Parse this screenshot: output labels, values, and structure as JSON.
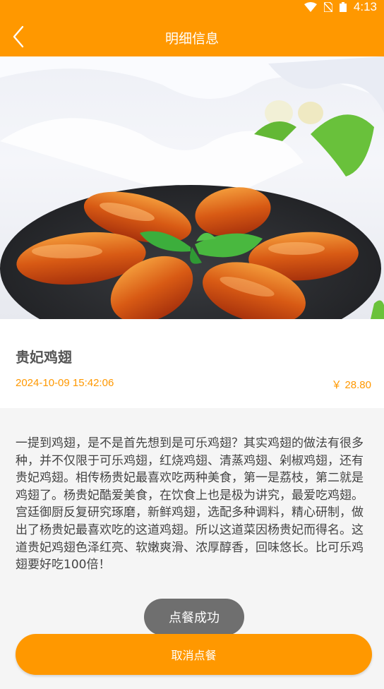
{
  "status_bar": {
    "time": "4:13",
    "wifi_icon": "wifi-icon",
    "sim_icon": "no-sim-icon",
    "battery_icon": "battery-icon"
  },
  "header": {
    "title": "明细信息",
    "back_icon": "back-arrow-icon"
  },
  "dish": {
    "name": "贵妃鸡翅",
    "datetime": "2024-10-09 15:42:06",
    "price": "￥ 28.80",
    "description": "一提到鸡翅，是不是首先想到是可乐鸡翅？其实鸡翅的做法有很多种，并不仅限于可乐鸡翅，红烧鸡翅、清蒸鸡翅、剁椒鸡翅，还有贵妃鸡翅。相传杨贵妃最喜欢吃两种美食，第一是荔枝，第二就是鸡翅了。杨贵妃酷爱美食，在饮食上也是极为讲究，最爱吃鸡翅。宫廷御厨反复研究琢磨，新鲜鸡翅，选配多种调料，精心研制，做出了杨贵妃最喜欢吃的这道鸡翅。所以这道菜因杨贵妃而得名。这道贵妃鸡翅色泽红亮、软嫩爽滑、浓厚醇香，回味悠长。比可乐鸡翅要好吃100倍！"
  },
  "toast": {
    "text": "点餐成功"
  },
  "actions": {
    "cancel_label": "取消点餐"
  },
  "colors": {
    "accent": "#FF9800",
    "toast_bg": "#606060",
    "desc_bg": "#f5f5f5"
  }
}
